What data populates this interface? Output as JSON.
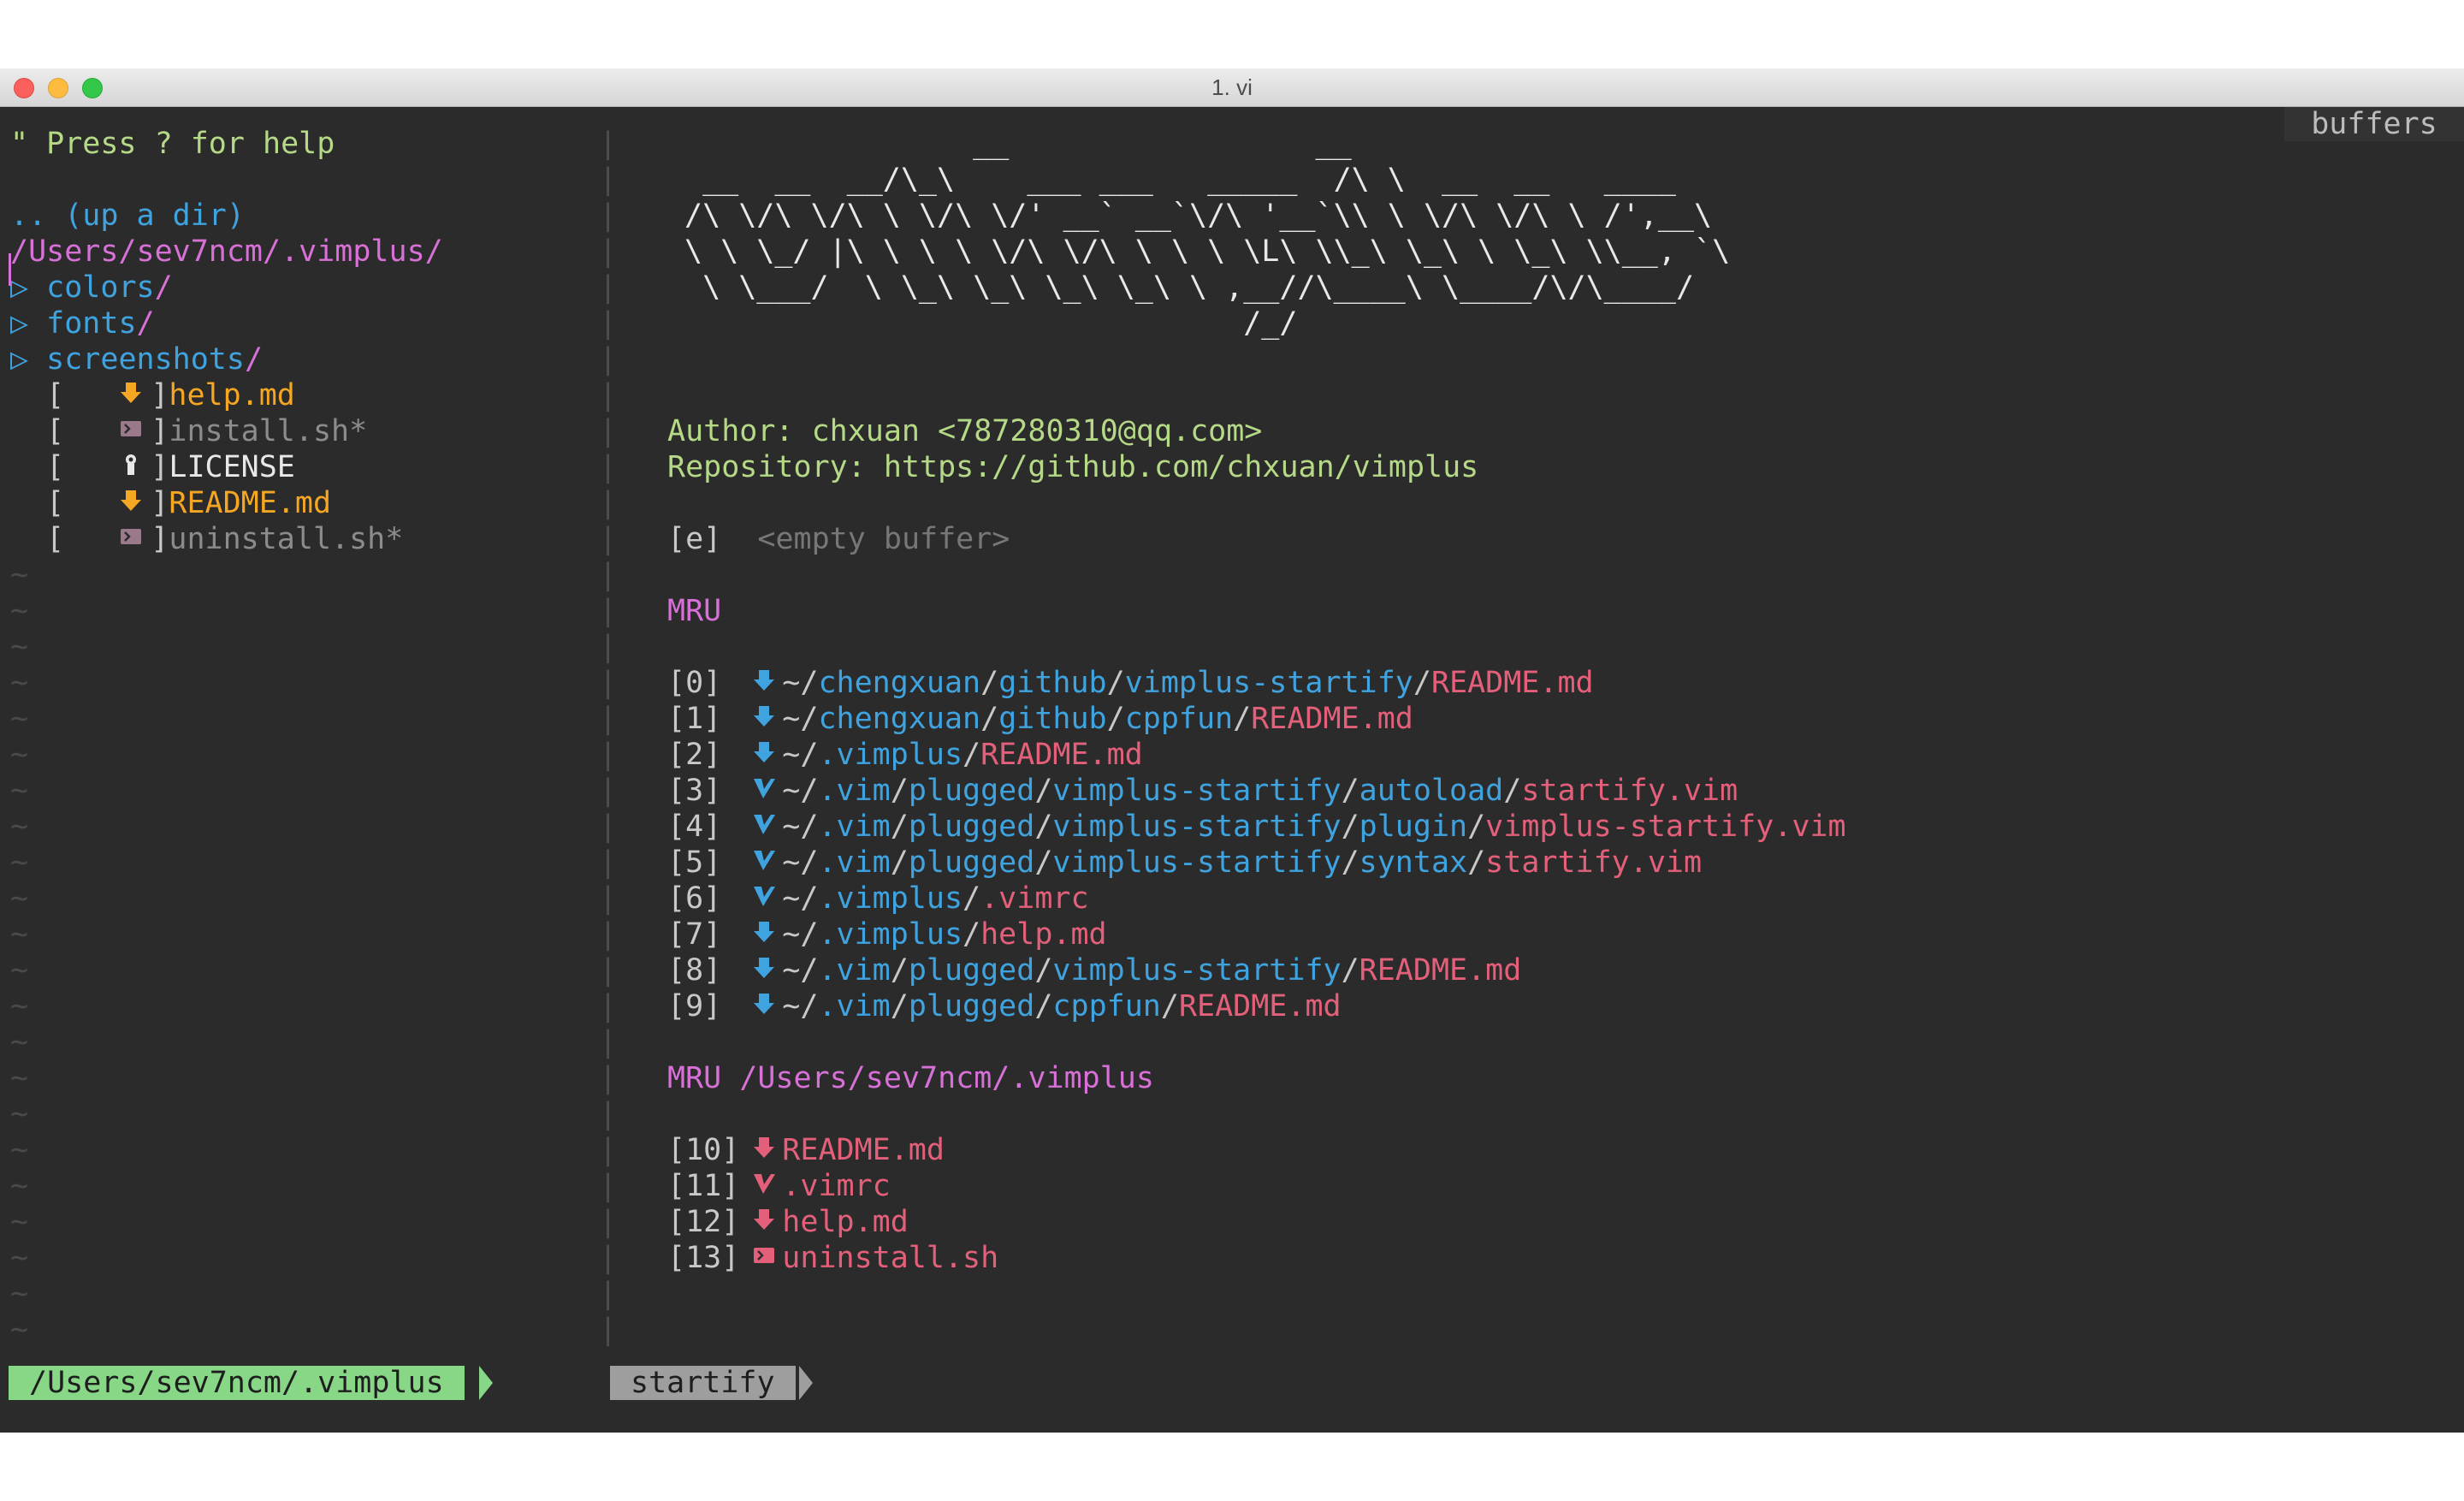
{
  "window": {
    "title": "1. vi",
    "buffers_label": "buffers"
  },
  "tree": {
    "help_hint": "\" Press ? for help",
    "up_dir": ".. (up a dir)",
    "root_path": "/Users/sev7ncm/.vimplus/",
    "dirs": [
      {
        "name": "colors",
        "slash": "/",
        "arrow": "▷"
      },
      {
        "name": "fonts",
        "slash": "/",
        "arrow": "▷"
      },
      {
        "name": "screenshots",
        "slash": "/",
        "arrow": "▷"
      }
    ],
    "files": [
      {
        "open": "[",
        "close": "]",
        "name": "help.md",
        "icon": "markdown-icon",
        "color": "#f5a623"
      },
      {
        "open": "[",
        "close": "]",
        "name": "install.sh*",
        "icon": "shell-icon",
        "color": "#8c8c8c"
      },
      {
        "open": "[",
        "close": "]",
        "name": "LICENSE",
        "icon": "license-icon",
        "color": "#e8e8e8"
      },
      {
        "open": "[",
        "close": "]",
        "name": "README.md",
        "icon": "markdown-icon",
        "color": "#f5a623"
      },
      {
        "open": "[",
        "close": "]",
        "name": "uninstall.sh*",
        "icon": "shell-icon",
        "color": "#8c8c8c"
      }
    ],
    "tilde": "~"
  },
  "startify": {
    "ascii_art": [
      "                __                 __",
      " __  __  __/\\_\\    ___ ___   _____  /\\ \\  __  __   ____",
      "/\\ \\/\\ \\/\\ \\ \\/\\ \\/' __` __`\\/\\ '__`\\\\ \\ \\/\\ \\/\\ \\ /',__\\",
      "\\ \\ \\_/ |\\ \\ \\ \\ \\/\\ \\/\\ \\ \\ \\ \\L\\ \\\\_\\ \\_\\ \\ \\_\\ \\\\__, `\\",
      " \\ \\___/  \\ \\_\\ \\_\\ \\_\\ \\_\\ \\ ,__//\\____\\ \\____/\\/\\____/",
      "                               /_/"
    ],
    "author": "Author: chxuan <787280310@qq.com>",
    "repository": "Repository: https://github.com/chxuan/vimplus",
    "empty_key": "[e]",
    "empty_label": "<empty buffer>",
    "mru_heading": "MRU",
    "mru": [
      {
        "key": "[0]",
        "icon": "markdown-icon",
        "path": [
          "~/",
          "chengxuan",
          "/",
          "github",
          "/",
          "vimplus-startify",
          "/",
          "README.md"
        ]
      },
      {
        "key": "[1]",
        "icon": "markdown-icon",
        "path": [
          "~/",
          "chengxuan",
          "/",
          "github",
          "/",
          "cppfun",
          "/",
          "README.md"
        ]
      },
      {
        "key": "[2]",
        "icon": "markdown-icon",
        "path": [
          "~/",
          ".vimplus",
          "/",
          "README.md"
        ]
      },
      {
        "key": "[3]",
        "icon": "vim-icon",
        "path": [
          "~/",
          ".vim",
          "/",
          "plugged",
          "/",
          "vimplus-startify",
          "/",
          "autoload",
          "/",
          "startify.vim"
        ]
      },
      {
        "key": "[4]",
        "icon": "vim-icon",
        "path": [
          "~/",
          ".vim",
          "/",
          "plugged",
          "/",
          "vimplus-startify",
          "/",
          "plugin",
          "/",
          "vimplus-startify.vim"
        ]
      },
      {
        "key": "[5]",
        "icon": "vim-icon",
        "path": [
          "~/",
          ".vim",
          "/",
          "plugged",
          "/",
          "vimplus-startify",
          "/",
          "syntax",
          "/",
          "startify.vim"
        ]
      },
      {
        "key": "[6]",
        "icon": "vim-icon",
        "path": [
          "~/",
          ".vimplus",
          "/",
          ".vimrc"
        ]
      },
      {
        "key": "[7]",
        "icon": "markdown-icon",
        "path": [
          "~/",
          ".vimplus",
          "/",
          "help.md"
        ]
      },
      {
        "key": "[8]",
        "icon": "markdown-icon",
        "path": [
          "~/",
          ".vim",
          "/",
          "plugged",
          "/",
          "vimplus-startify",
          "/",
          "README.md"
        ]
      },
      {
        "key": "[9]",
        "icon": "markdown-icon",
        "path": [
          "~/",
          ".vim",
          "/",
          "plugged",
          "/",
          "cppfun",
          "/",
          "README.md"
        ]
      }
    ],
    "mru_dir_heading": "MRU",
    "mru_dir_path": "/Users/sev7ncm/.vimplus",
    "mru_dir": [
      {
        "key": "[10]",
        "icon": "markdown-icon",
        "name": "README.md"
      },
      {
        "key": "[11]",
        "icon": "vim-icon",
        "name": ".vimrc"
      },
      {
        "key": "[12]",
        "icon": "markdown-icon",
        "name": "help.md"
      },
      {
        "key": "[13]",
        "icon": "shell-icon",
        "name": "uninstall.sh"
      }
    ]
  },
  "statusline": {
    "left": "/Users/sev7ncm/.vimplus",
    "right": "startify"
  },
  "colors": {
    "background": "#2b2b2b",
    "dir_blue": "#3fa3e0",
    "path_purple": "#d770d7",
    "file_pink": "#e4607a",
    "markdown_yellow": "#f5a623",
    "help_green": "#b5d986",
    "status_green": "#87d787",
    "status_grey": "#9e9e9e"
  }
}
